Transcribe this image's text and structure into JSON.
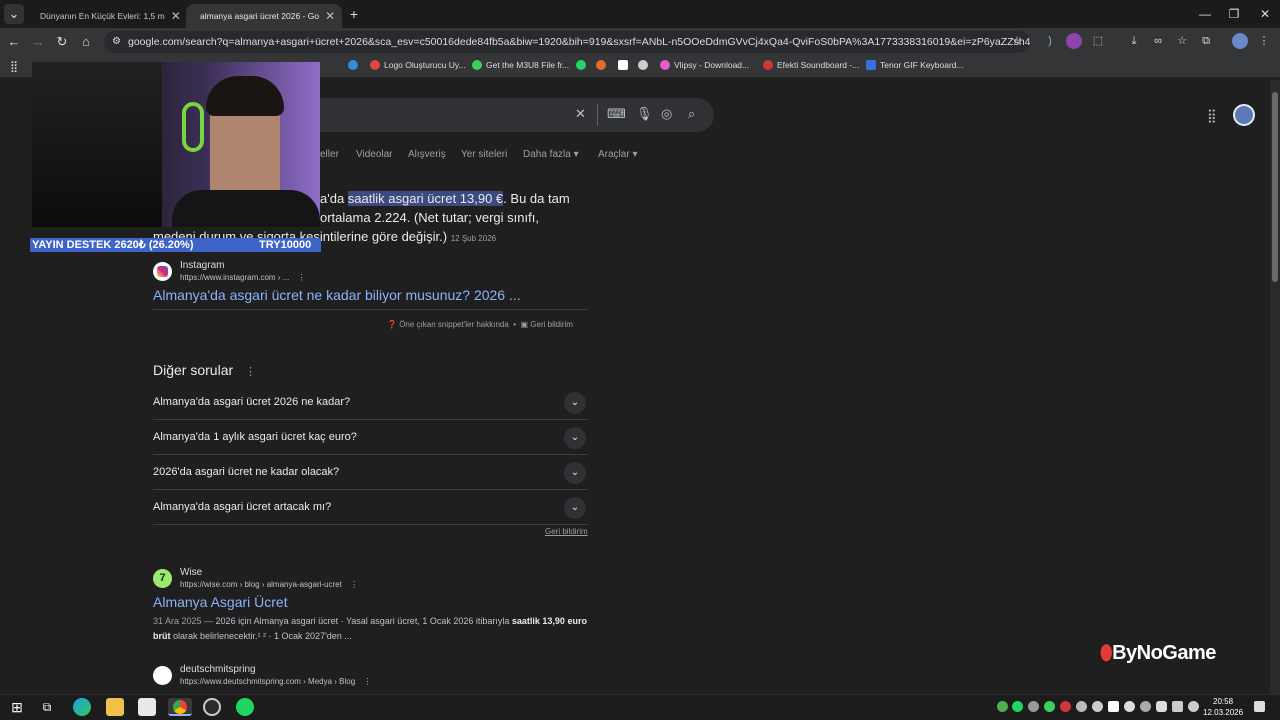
{
  "browser": {
    "tabs": [
      {
        "title": "Dünyanın En Küçük Evleri: 1,5 m",
        "active": false
      },
      {
        "title": "almanya asgari ücret 2026 - Go",
        "active": true
      }
    ],
    "new_tab": "+",
    "url": "google.com/search?q=almanya+asgari+ücret+2026&sca_esv=c50016dede84fb5a&biw=1920&bih=919&sxsrf=ANbL-n5OOeDdmGVvCj4xQa4-QviFoS0bPA%3A1773338316019&ei=zP6yaZZsh47s1g_KnrbpBQ&v...",
    "bookmarks": [
      {
        "label": "Logo Oluşturucu Uy...",
        "color": "#e0483a"
      },
      {
        "label": "Get the M3U8 File fr...",
        "color": "#3ccf5a"
      },
      {
        "label": "Vlipsy - Download...",
        "color": "#e25bd1"
      },
      {
        "label": "Efekti Soundboard -...",
        "color": "#d13636"
      },
      {
        "label": "Tenor GIF Keyboard...",
        "color": "#3b6fd9"
      }
    ]
  },
  "search": {
    "nav_tabs": [
      "eller",
      "Videolar",
      "Alışveriş",
      "Yer siteleri",
      "Daha fazla",
      "Araçlar"
    ]
  },
  "snippet": {
    "text_pre": "a'da ",
    "highlight": "saatlik asgari ücret 13,90 €",
    "text_post": ". Bu da tam",
    "line2": "ortalama 2.224. (Net tutar; vergi sınıfı,",
    "line3": "medeni durum ve sigorta kesintilerine göre değişir.)",
    "date": "12 Şub 2026",
    "source_name": "Instagram",
    "source_url": "https://www.instagram.com › ...",
    "title": "Almanya'da asgari ücret ne kadar biliyor musunuz? 2026 ...",
    "about": "Öne çıkan snippet'ler hakkında",
    "feedback": "Geri bildirim"
  },
  "people_also_ask": {
    "heading": "Diğer sorular",
    "questions": [
      "Almanya'da asgari ücret 2026 ne kadar?",
      "Almanya'da 1 aylık asgari ücret kaç euro?",
      "2026'da asgari ücret ne kadar olacak?",
      "Almanya'da asgari ücret artacak mı?"
    ],
    "feedback": "Geri bildirim"
  },
  "results": [
    {
      "site": "Wise",
      "url": "https://wise.com › blog › almanya-asgari-ucret",
      "title": "Almanya Asgari Ücret",
      "date": "31 Ara 2025 — ",
      "desc_a": "2026 için Almanya asgari ücret · Yasal asgari ücret, 1 Ocak 2026 itibarıyla ",
      "desc_bold1": "saatlik 13,90",
      "desc_bold2": "euro brüt",
      "desc_b": " olarak belirlenecektir.¹ ² · 1 Ocak 2027'den ..."
    },
    {
      "site": "deutschmitspring",
      "url": "https://www.deutschmitspring.com › Medya › Blog"
    }
  ],
  "overlay": {
    "stream_left": "YAYIN DESTEK 2620₺ (26.20%)",
    "stream_right": "TRY10000",
    "watermark": "ByNoGame"
  },
  "taskbar": {
    "time": "20:58",
    "date": "12.03.2026"
  }
}
